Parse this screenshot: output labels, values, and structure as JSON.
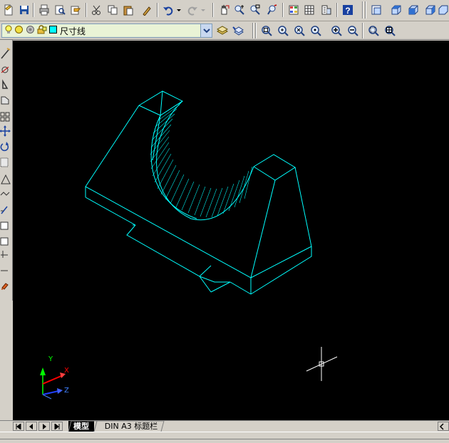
{
  "toolbar_standard": {
    "icons": [
      "new-icon",
      "save-icon",
      "print-icon",
      "print-preview-icon",
      "publish-icon",
      "cut-icon",
      "copy-icon",
      "paste-icon",
      "match-properties-icon",
      "undo-icon",
      "undo-dropdown-icon",
      "redo-icon",
      "redo-dropdown-icon",
      "pan-icon",
      "zoom-realtime-icon",
      "zoom-window-icon",
      "zoom-previous-icon",
      "properties-icon",
      "design-center-icon",
      "tool-palettes-icon",
      "help-icon",
      "named-views-icon",
      "top-view-icon",
      "front-view-icon",
      "right-view-icon"
    ]
  },
  "layer": {
    "current_layer_name": "尺寸线",
    "state_icons": [
      "on-bulb-icon",
      "freeze-sun-icon",
      "lock-icon",
      "color-swatch-icon"
    ],
    "layer_color": "#00ffff"
  },
  "toolbar_zoom": {
    "icons": [
      "layer-manager-icon",
      "layer-previous-icon",
      "zoom-window-icon",
      "zoom-dynamic-icon",
      "zoom-scale-icon",
      "zoom-center-icon",
      "zoom-in-icon",
      "zoom-out-icon",
      "zoom-all-icon",
      "zoom-extents-icon"
    ]
  },
  "toolbar_draw": {
    "icons": [
      "line-icon",
      "construction-line-icon",
      "polyline-icon",
      "polygon-icon",
      "rectangle-icon",
      "arc-icon",
      "circle-icon",
      "revision-cloud-icon",
      "spline-icon",
      "ellipse-icon",
      "ellipse-arc-icon",
      "insert-block-icon",
      "make-block-icon",
      "point-icon",
      "hatch-icon",
      "region-icon",
      "table-icon",
      "multiline-text-icon"
    ]
  },
  "ucs": {
    "x_label": "X",
    "y_label": "Y",
    "z_label": "Z"
  },
  "tabs": {
    "model": "模型",
    "layout": "DIN A3 标题栏"
  },
  "colors": {
    "canvas_bg": "#000000",
    "drawing_line": "#00ffff",
    "crosshair": "#ffffff"
  }
}
